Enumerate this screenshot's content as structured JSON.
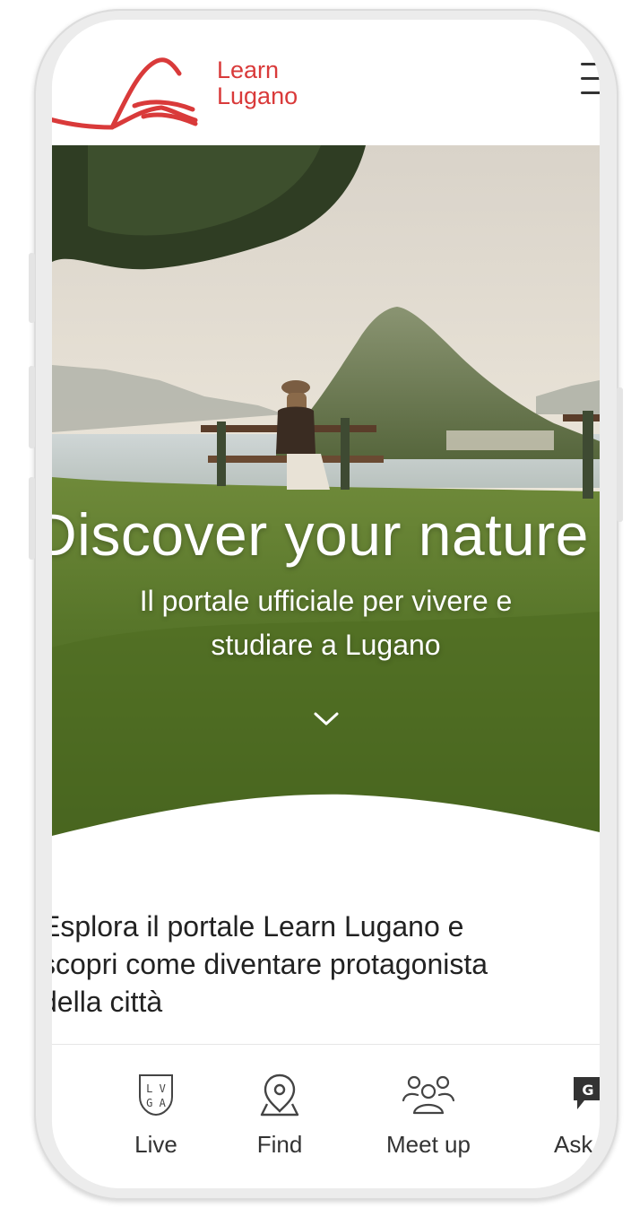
{
  "header": {
    "logo_line1": "Learn",
    "logo_line2": "Lugano",
    "brand_color": "#d93a3a",
    "menu_icon": "hamburger-menu-icon"
  },
  "hero": {
    "title": "Discover your nature",
    "subtitle_line1": "Il portale ufficiale per vivere e",
    "subtitle_line2": "studiare a Lugano",
    "scroll_icon": "chevron-down-icon"
  },
  "intro": {
    "line1": "Esplora il portale Learn Lugano e",
    "line2": "scopri come diventare protagonista",
    "line3": "della città"
  },
  "bottom_nav": {
    "items": [
      {
        "label": "Live",
        "icon": "lvga-badge-icon"
      },
      {
        "label": "Find",
        "icon": "map-pin-icon"
      },
      {
        "label": "Meet up",
        "icon": "people-group-icon"
      },
      {
        "label": "Ask",
        "icon": "chat-bubble-icon"
      }
    ]
  }
}
